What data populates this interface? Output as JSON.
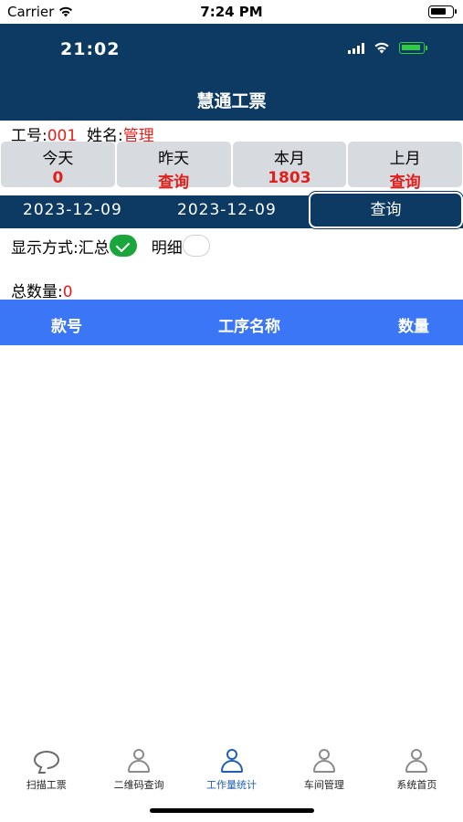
{
  "ios_status": {
    "carrier": "Carrier",
    "time": "7:24 PM"
  },
  "app_status": {
    "time": "21:02"
  },
  "header": {
    "title": "慧通工票"
  },
  "user": {
    "id_label": "工号:",
    "id_value": "001",
    "name_label": "姓名:",
    "name_value": "管理"
  },
  "stats": [
    {
      "label": "今天",
      "value": "0"
    },
    {
      "label": "昨天",
      "value": "查询"
    },
    {
      "label": "本月",
      "value": "1803"
    },
    {
      "label": "上月",
      "value": "查询"
    }
  ],
  "date_filter": {
    "start_date": "2023-12-09",
    "end_date": "2023-12-09",
    "query_label": "查询"
  },
  "display_mode": {
    "label": "显示方式:",
    "summary_label": "汇总",
    "summary_selected": true,
    "detail_label": "明细",
    "detail_selected": false
  },
  "total": {
    "label": "总数量:",
    "value": "0"
  },
  "table": {
    "columns": [
      "款号",
      "工序名称",
      "数量"
    ],
    "rows": []
  },
  "tabbar": {
    "items": [
      {
        "label": "扫描工票",
        "icon": "chat-bubble-icon",
        "active": false
      },
      {
        "label": "二维码查询",
        "icon": "person-icon",
        "active": false
      },
      {
        "label": "工作量统计",
        "icon": "person-icon",
        "active": true
      },
      {
        "label": "车间管理",
        "icon": "person-icon",
        "active": false
      },
      {
        "label": "系统首页",
        "icon": "person-icon",
        "active": false
      }
    ]
  },
  "colors": {
    "header_bg": "#0c3a63",
    "table_header_bg": "#3b76f7",
    "value_red": "#e0201c",
    "check_green": "#1aa63a",
    "tab_active": "#1f5fb3"
  }
}
